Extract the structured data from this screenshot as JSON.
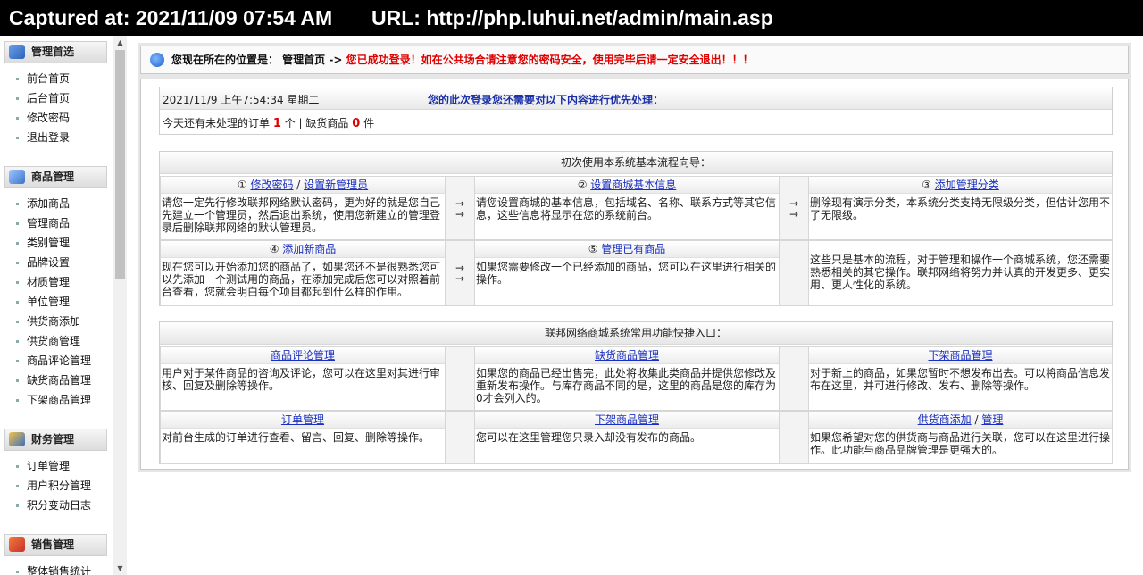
{
  "capture": {
    "label": "Captured at: 2021/11/09 07:54 AM",
    "url": "URL: http://php.luhui.net/admin/main.asp"
  },
  "sidebar": {
    "sections": [
      {
        "title": "管理首选",
        "icon": "network-icon",
        "items": [
          "前台首页",
          "后台首页",
          "修改密码",
          "退出登录"
        ]
      },
      {
        "title": "商品管理",
        "icon": "product-icon",
        "items": [
          "添加商品",
          "管理商品",
          "类别管理",
          "品牌设置",
          "材质管理",
          "单位管理",
          "供货商添加",
          "供货商管理",
          "商品评论管理",
          "缺货商品管理",
          "下架商品管理"
        ]
      },
      {
        "title": "财务管理",
        "icon": "finance-icon",
        "items": [
          "订单管理",
          "用户积分管理",
          "积分变动日志"
        ]
      },
      {
        "title": "销售管理",
        "icon": "sales-icon",
        "items": [
          "整体销售统计"
        ]
      }
    ]
  },
  "breadcrumb": {
    "prefix": "您现在所在的位置是： 管理首页 ->",
    "warning": "您已成功登录！如在公共场合请注意您的密码安全，使用完毕后请一定安全退出！！！"
  },
  "status": {
    "datetime": "2021/11/9 上午7:54:34 星期二",
    "priority": "您的此次登录您还需要对以下内容进行优先处理：",
    "orders_prefix": "今天还有未处理的订单",
    "orders_count": "1",
    "orders_suffix": "个 | 缺货商品",
    "out_of_stock_count": "0",
    "out_of_stock_suffix": "件"
  },
  "guide": {
    "title": "初次使用本系统基本流程向导：",
    "steps": [
      {
        "num": "①",
        "links": [
          "修改密码",
          "设置新管理员"
        ],
        "desc": "请您一定先行修改联邦网络默认密码，更为好的就是您自己先建立一个管理员，然后退出系统，使用您新建立的管理登录后删除联邦网络的默认管理员。"
      },
      {
        "num": "②",
        "links": [
          "设置商城基本信息"
        ],
        "desc": "请您设置商城的基本信息，包括域名、名称、联系方式等其它信息，这些信息将显示在您的系统前台。"
      },
      {
        "num": "③",
        "links": [
          "添加管理分类"
        ],
        "desc": "删除现有演示分类，本系统分类支持无限级分类，但估计您用不了无限级。"
      },
      {
        "num": "④",
        "links": [
          "添加新商品"
        ],
        "desc": "现在您可以开始添加您的商品了，如果您还不是很熟悉您可以先添加一个测试用的商品，在添加完成后您可以对照着前台查看，您就会明白每个项目都起到什么样的作用。"
      },
      {
        "num": "⑤",
        "links": [
          "管理已有商品"
        ],
        "desc": "如果您需要修改一个已经添加的商品，您可以在这里进行相关的操作。"
      }
    ],
    "note": "这些只是基本的流程，对于管理和操作一个商城系统，您还需要熟悉相关的其它操作。联邦网络将努力并认真的开发更多、更实用、更人性化的系统。",
    "arrow": "→"
  },
  "shortcuts": {
    "title": "联邦网络商城系统常用功能快捷入口：",
    "items": [
      {
        "links": [
          "商品评论管理"
        ],
        "desc": "用户对于某件商品的咨询及评论，您可以在这里对其进行审核、回复及删除等操作。"
      },
      {
        "links": [
          "缺货商品管理"
        ],
        "desc": "如果您的商品已经出售完，此处将收集此类商品并提供您修改及重新发布操作。与库存商品不同的是，这里的商品是您的库存为0才会列入的。"
      },
      {
        "links": [
          "下架商品管理"
        ],
        "desc": "对于新上的商品，如果您暂时不想发布出去。可以将商品信息发布在这里，并可进行修改、发布、删除等操作。"
      },
      {
        "links": [
          "订单管理"
        ],
        "desc": "对前台生成的订单进行查看、留言、回复、删除等操作。"
      },
      {
        "links": [
          "下架商品管理"
        ],
        "desc": "您可以在这里管理您只录入却没有发布的商品。"
      },
      {
        "links": [
          "供货商添加",
          "管理"
        ],
        "desc": "如果您希望对您的供货商与商品进行关联，您可以在这里进行操作。此功能与商品品牌管理是更强大的。"
      }
    ]
  },
  "colors": {
    "warning": "#e00000",
    "link": "#1a30c0",
    "priority": "#1a30a8"
  }
}
